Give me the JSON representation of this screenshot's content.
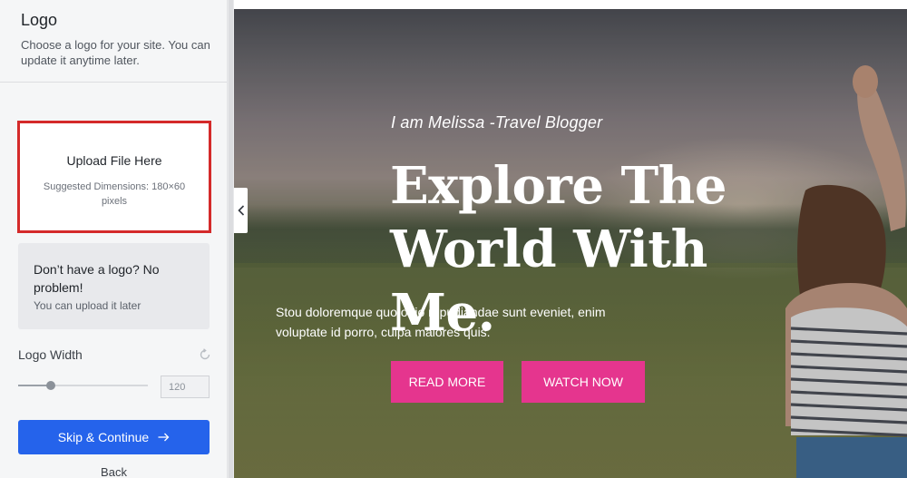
{
  "sidebar": {
    "title": "Logo",
    "description": "Choose a logo for your site. You can update it anytime later.",
    "upload": {
      "title": "Upload File Here",
      "hint": "Suggested Dimensions: 180×60 pixels"
    },
    "no_logo": {
      "title": "Don’t have a logo? No problem!",
      "subtitle": "You can upload it later"
    },
    "logo_width": {
      "label": "Logo Width",
      "value": "120",
      "slider_fraction": 0.25,
      "reset_icon": "reset-icon"
    },
    "skip_button": {
      "label": "Skip & Continue",
      "icon": "arrow-right-icon"
    },
    "back_label": "Back"
  },
  "preview": {
    "collapse_icon": "chevron-left-icon",
    "tagline": "I am Melissa -Travel Blogger",
    "headline": "Explore The World With Me.",
    "body": "Stou doloremque quo odio repudiandae sunt eveniet, enim voluptate id porro, culpa maiores quis.",
    "buttons": {
      "read_more": "READ MORE",
      "watch_now": "WATCH NOW"
    }
  },
  "colors": {
    "primary_blue": "#2563eb",
    "highlight_red": "#d42a2a",
    "accent_pink": "#e5358e"
  }
}
